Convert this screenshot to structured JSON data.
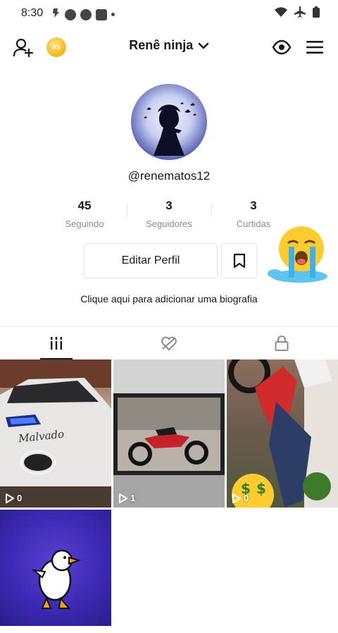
{
  "status_bar": {
    "time": "8:30",
    "left_icons": [
      "app-notification-icon",
      "message-icon",
      "spotify-icon",
      "capcut-icon",
      "dot-icon"
    ],
    "right_icons": [
      "wifi-icon",
      "airplane-mode-icon",
      "battery-icon"
    ]
  },
  "header": {
    "username": "Renê ninja",
    "coin_label": "R$"
  },
  "profile": {
    "handle": "@renematos12",
    "stats": [
      {
        "value": "45",
        "label": "Seguindo"
      },
      {
        "value": "3",
        "label": "Seguidores"
      },
      {
        "value": "3",
        "label": "Curtidas"
      }
    ],
    "edit_label": "Editar Perfil",
    "bio_prompt": "Clique aqui para adicionar uma biografia"
  },
  "tabs": [
    "videos-grid-icon",
    "liked-videos-icon",
    "private-lock-icon"
  ],
  "videos": [
    {
      "views": "0",
      "caption": "Malvado"
    },
    {
      "views": "1"
    },
    {
      "views": "0"
    },
    {
      "views": ""
    }
  ],
  "colors": {
    "text": "#161823",
    "muted": "#8a8b91",
    "divider": "#e3e3e4",
    "coin": "#f3b61b"
  }
}
